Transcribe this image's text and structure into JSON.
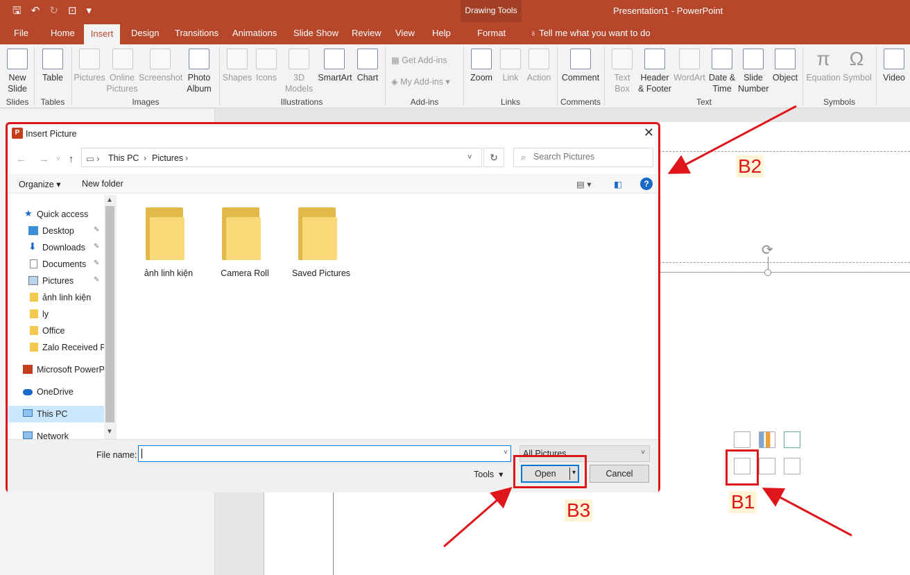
{
  "app": {
    "doc_title": "Presentation1  -  PowerPoint",
    "drawing_tools": "Drawing Tools",
    "qat": {
      "save": "🖫",
      "undo": "↶",
      "redo": "↻",
      "present": "⊡",
      "more": "▾"
    }
  },
  "tabs": [
    "File",
    "Home",
    "Insert",
    "Design",
    "Transitions",
    "Animations",
    "Slide Show",
    "Review",
    "View",
    "Help",
    "Format"
  ],
  "active_tab": "Insert",
  "tell_me": "Tell me what you want to do",
  "ribbon": {
    "new_slide": "New\nSlide",
    "table": "Table",
    "pictures": "Pictures",
    "online_pictures": "Online\nPictures",
    "screenshot": "Screenshot",
    "photo_album": "Photo\nAlbum",
    "shapes": "Shapes",
    "icons": "Icons",
    "models_3d": "3D\nModels",
    "smartart": "SmartArt",
    "chart": "Chart",
    "get_addins": "Get Add-ins",
    "my_addins": "My Add-ins",
    "zoom": "Zoom",
    "link": "Link",
    "action": "Action",
    "comment": "Comment",
    "text_box": "Text\nBox",
    "header_footer": "Header\n& Footer",
    "wordart": "WordArt",
    "date_time": "Date &\nTime",
    "slide_number": "Slide\nNumber",
    "object": "Object",
    "equation": "Equation",
    "symbol": "Symbol",
    "video": "Video",
    "groups": {
      "slides": "Slides",
      "tables": "Tables",
      "images": "Images",
      "illustrations": "Illustrations",
      "addins": "Add-ins",
      "links": "Links",
      "comments": "Comments",
      "text": "Text",
      "symbols": "Symbols"
    }
  },
  "dialog": {
    "title": "Insert Picture",
    "breadcrumb": [
      "This PC",
      "Pictures"
    ],
    "search_placeholder": "Search Pictures",
    "organize": "Organize",
    "new_folder": "New folder",
    "nav": [
      {
        "label": "Quick access",
        "pinned": false
      },
      {
        "label": "Desktop",
        "pinned": true
      },
      {
        "label": "Downloads",
        "pinned": true
      },
      {
        "label": "Documents",
        "pinned": true
      },
      {
        "label": "Pictures",
        "pinned": true
      },
      {
        "label": "ảnh linh kiện",
        "pinned": false
      },
      {
        "label": "ly",
        "pinned": false
      },
      {
        "label": "Office",
        "pinned": false
      },
      {
        "label": "Zalo Received Fi",
        "pinned": false
      },
      {
        "label": "Microsoft PowerP",
        "pinned": false
      },
      {
        "label": "OneDrive",
        "pinned": false
      },
      {
        "label": "This PC",
        "pinned": false
      },
      {
        "label": "Network",
        "pinned": false
      }
    ],
    "folders": [
      "ảnh linh kiện",
      "Camera Roll",
      "Saved Pictures"
    ],
    "file_name_label": "File name:",
    "file_name_value": "",
    "filter": "All Pictures",
    "tools": "Tools",
    "open": "Open",
    "cancel": "Cancel"
  },
  "annotations": {
    "b1": "B1",
    "b2": "B2",
    "b3": "B3"
  },
  "colors": {
    "accent": "#b7472a",
    "highlight": "#e0151a"
  }
}
